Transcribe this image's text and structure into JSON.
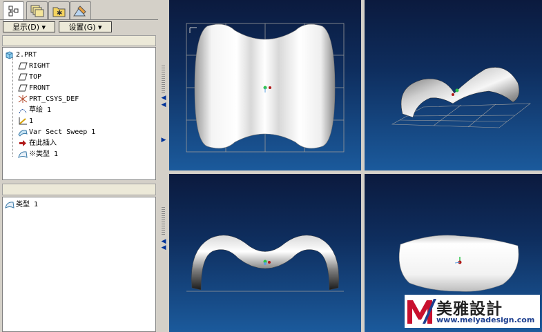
{
  "colors": {
    "panel_bg": "#d4d0c8",
    "viewport_top": "#0b1a3e",
    "viewport_bottom": "#1b5a9c",
    "logo_red": "#c8102e",
    "logo_blue": "#1d3f8f"
  },
  "tabs": [
    {
      "icon": "model-tree-icon",
      "active": true
    },
    {
      "icon": "layers-icon",
      "active": false
    },
    {
      "icon": "folder-browser-icon",
      "active": false
    },
    {
      "icon": "favorites-tools-icon",
      "active": false
    }
  ],
  "toolbar": {
    "show_label": "显示(D) ▾",
    "settings_label": "设置(G) ▾"
  },
  "model_tree": {
    "items": [
      {
        "label": "2.PRT",
        "icon": "part-icon"
      },
      {
        "label": "RIGHT",
        "icon": "datum-plane-icon"
      },
      {
        "label": "TOP",
        "icon": "datum-plane-icon"
      },
      {
        "label": "FRONT",
        "icon": "datum-plane-icon"
      },
      {
        "label": "PRT_CSYS_DEF",
        "icon": "coordinate-system-icon"
      },
      {
        "label": "草绘 1",
        "icon": "sketch-icon"
      },
      {
        "label": "1",
        "icon": "datum-axis-icon"
      },
      {
        "label": "Var Sect Sweep 1",
        "icon": "sweep-feature-icon"
      },
      {
        "label": "在此插入",
        "icon": "insert-here-arrow-icon"
      },
      {
        "label": "※类型 1",
        "icon": "surface-icon"
      }
    ]
  },
  "lower_tree": {
    "items": [
      {
        "label": "类型 1",
        "icon": "surface-icon"
      }
    ]
  },
  "logo": {
    "mark": "M",
    "name": "美雅設計",
    "url": "www.meiyadesign.com"
  }
}
